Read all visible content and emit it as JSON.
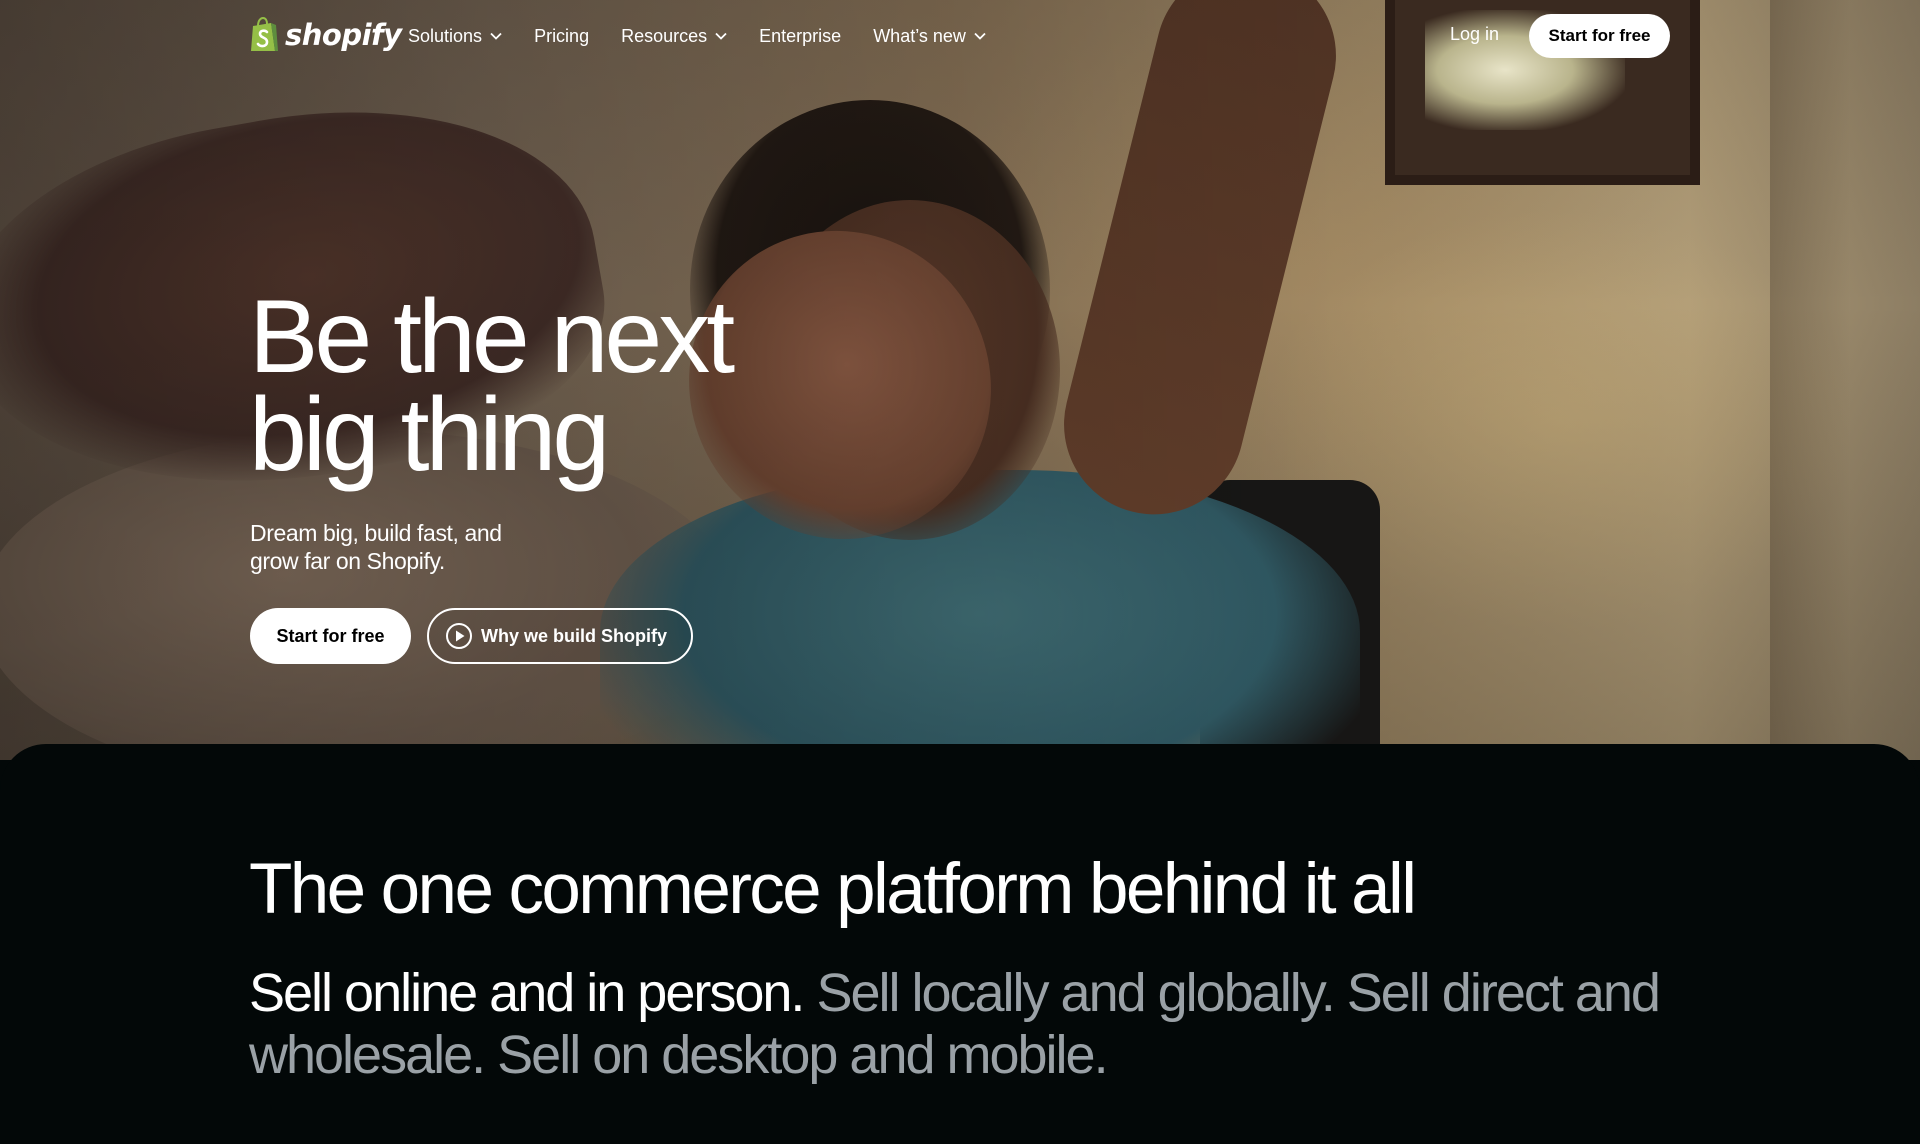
{
  "nav": {
    "logo_text": "shopify",
    "items": [
      {
        "label": "Solutions",
        "has_dropdown": true
      },
      {
        "label": "Pricing",
        "has_dropdown": false
      },
      {
        "label": "Resources",
        "has_dropdown": true
      },
      {
        "label": "Enterprise",
        "has_dropdown": false
      },
      {
        "label": "What’s new",
        "has_dropdown": true
      }
    ],
    "login_label": "Log in",
    "cta_label": "Start for free"
  },
  "hero": {
    "title_line1": "Be the next",
    "title_line2": "big thing",
    "subtitle_line1": "Dream big, build fast, and",
    "subtitle_line2": "grow far on Shopify.",
    "primary_cta": "Start for free",
    "secondary_cta": "Why we build Shopify",
    "secondary_icon": "play-circle-icon"
  },
  "platform": {
    "title": "The one commerce platform behind it all",
    "sell_bright": "Sell online and in person.",
    "sell_dim": "Sell locally and globally. Sell direct and wholesale. Sell on desktop and mobile."
  },
  "colors": {
    "brand_green": "#95bf47",
    "dark_bg": "#030808",
    "dim_text": "#9aa1a6"
  }
}
